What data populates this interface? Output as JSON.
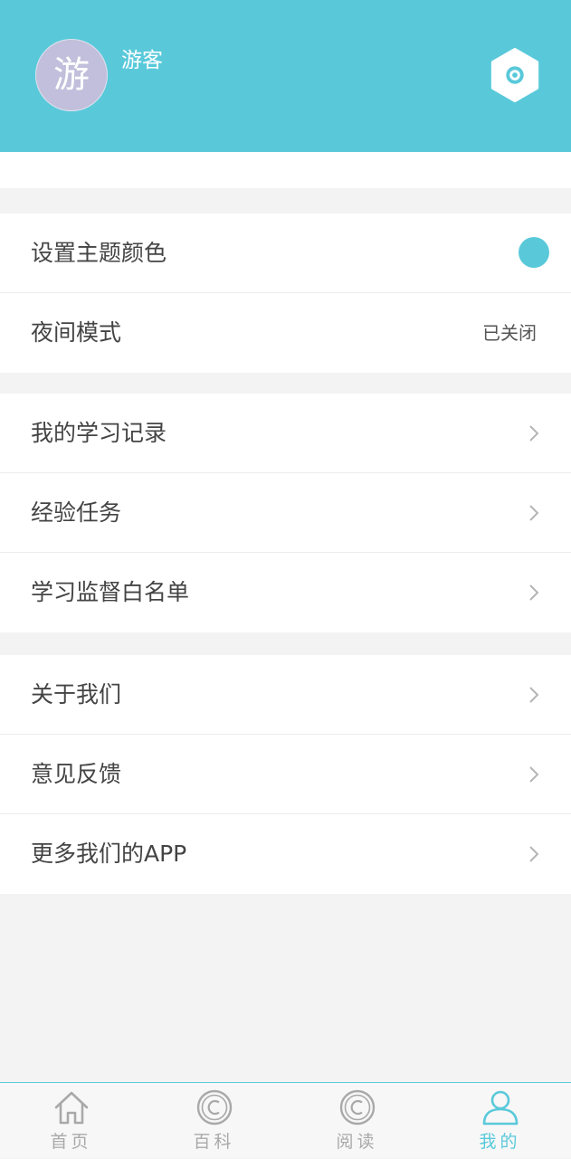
{
  "profile": {
    "avatar_char": "游",
    "username": "游客"
  },
  "settings_group": {
    "theme_label": "设置主题颜色",
    "theme_color": "#59c9da",
    "night_label": "夜间模式",
    "night_value": "已关闭"
  },
  "study_group": {
    "items": [
      {
        "label": "我的学习记录"
      },
      {
        "label": "经验任务"
      },
      {
        "label": "学习监督白名单"
      }
    ]
  },
  "about_group": {
    "items": [
      {
        "label": "关于我们"
      },
      {
        "label": "意见反馈"
      },
      {
        "label": "更多我们的APP"
      }
    ]
  },
  "tabbar": {
    "tabs": [
      {
        "label": "首页",
        "icon": "home-icon"
      },
      {
        "label": "百科",
        "icon": "copyright-icon"
      },
      {
        "label": "阅读",
        "icon": "copyright-icon"
      },
      {
        "label": "我的",
        "icon": "user-icon",
        "active": true
      }
    ]
  },
  "colors": {
    "accent": "#59c9da",
    "avatar_bg": "#c1bfdb",
    "page_bg": "#f3f3f3"
  }
}
